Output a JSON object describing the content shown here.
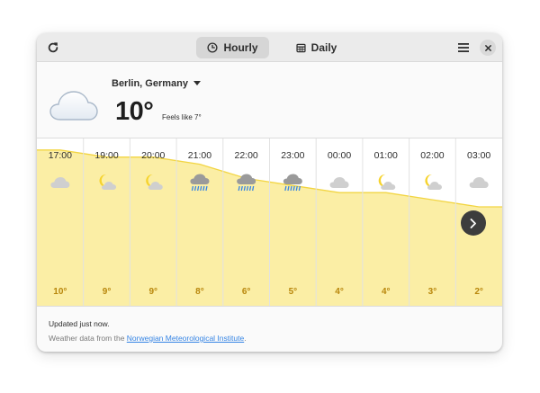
{
  "header": {
    "refresh_icon": "refresh-icon",
    "tabs": [
      {
        "label": "Hourly",
        "icon": "clock-icon",
        "selected": true
      },
      {
        "label": "Daily",
        "icon": "calendar-icon",
        "selected": false
      }
    ],
    "menu_icon": "hamburger-menu-icon",
    "close_icon": "close-icon"
  },
  "current": {
    "location": "Berlin, Germany",
    "temperature": "10°",
    "feels_like": "Feels like 7°",
    "condition_icon": "cloud-icon"
  },
  "chart_data": {
    "type": "area",
    "categories": [
      "17:00",
      "19:00",
      "20:00",
      "21:00",
      "22:00",
      "23:00",
      "00:00",
      "01:00",
      "02:00",
      "03:00"
    ],
    "values": [
      10,
      9,
      9,
      8,
      6,
      5,
      4,
      4,
      3,
      2
    ],
    "value_labels": [
      "10°",
      "9°",
      "9°",
      "8°",
      "6°",
      "5°",
      "4°",
      "4°",
      "3°",
      "2°"
    ],
    "conditions": [
      "overcast",
      "partly-cloudy-night",
      "partly-cloudy-night",
      "rain",
      "rain",
      "rain",
      "overcast",
      "partly-cloudy-night",
      "partly-cloudy-night",
      "overcast"
    ],
    "fill_color": "#fbeea5",
    "line_color": "#f2d543",
    "label_color": "#b8860b"
  },
  "footer": {
    "updated": "Updated just now.",
    "source_prefix": "Weather data from the ",
    "source_link": "Norwegian Meteorological Institute",
    "source_suffix": "."
  }
}
